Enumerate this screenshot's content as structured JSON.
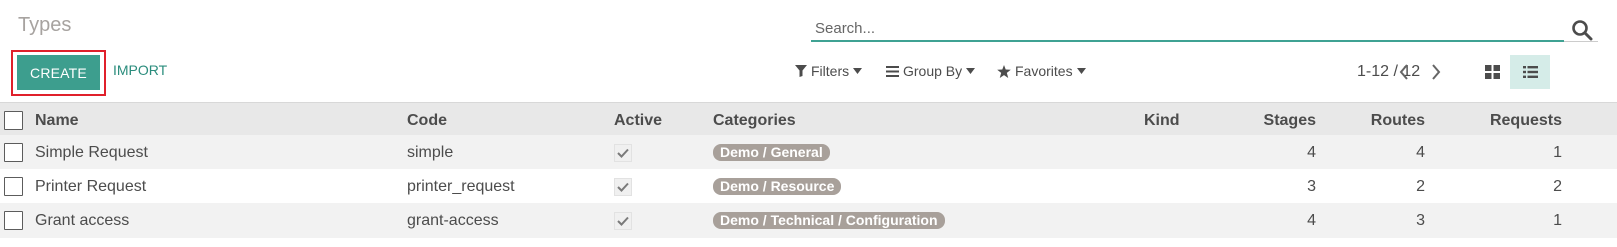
{
  "page": {
    "title": "Types"
  },
  "search": {
    "placeholder": "Search..."
  },
  "toolbar": {
    "create_label": "CREATE",
    "import_label": "IMPORT"
  },
  "filters": {
    "filters_label": "Filters",
    "group_by_label": "Group By",
    "favorites_label": "Favorites"
  },
  "pager": {
    "range": "1-12 / 12"
  },
  "views": {
    "active": "list"
  },
  "table": {
    "headers": {
      "name": "Name",
      "code": "Code",
      "active": "Active",
      "categories": "Categories",
      "kind": "Kind",
      "stages": "Stages",
      "routes": "Routes",
      "requests": "Requests"
    },
    "rows": [
      {
        "name": "Simple Request",
        "code": "simple",
        "active": true,
        "category": "Demo / General",
        "kind": "",
        "stages": "4",
        "routes": "4",
        "requests": "1"
      },
      {
        "name": "Printer Request",
        "code": "printer_request",
        "active": true,
        "category": "Demo / Resource",
        "kind": "",
        "stages": "3",
        "routes": "2",
        "requests": "2"
      },
      {
        "name": "Grant access",
        "code": "grant-access",
        "active": true,
        "category": "Demo / Technical / Configuration",
        "kind": "",
        "stages": "4",
        "routes": "3",
        "requests": "1"
      }
    ]
  },
  "colors": {
    "accent": "#3d9e8e",
    "tag": "#a8a09a",
    "highlight": "#e0202b"
  }
}
